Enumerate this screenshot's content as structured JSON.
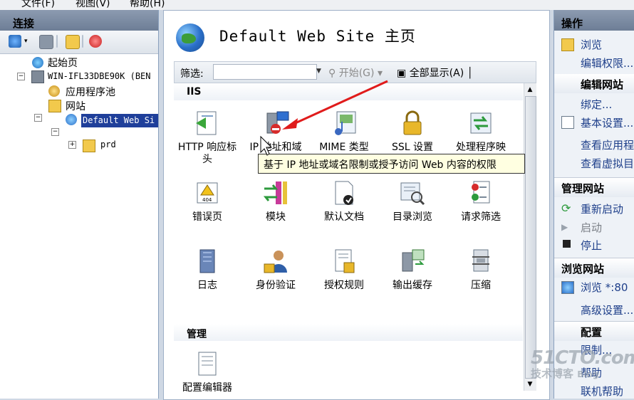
{
  "menu": {
    "items": [
      "文件(F)",
      "视图(V)",
      "帮助(H)"
    ]
  },
  "connections": {
    "title": "连接",
    "tree": {
      "start_page": "起始页",
      "server": "WIN-IFL33DBE90K (BEN",
      "app_pools": "应用程序池",
      "sites": "网站",
      "default_site": "Default Web Si",
      "prd": "prd"
    }
  },
  "center": {
    "title": "Default Web Site 主页",
    "filter_label": "筛选:",
    "filter_value": "",
    "start_label": "开始(G)",
    "show_all_label": "全部显示(A)",
    "sections": [
      {
        "title": "IIS"
      },
      {
        "title": "管理"
      }
    ],
    "iis_features": [
      "HTTP 响应标头",
      "IP 地址和域",
      "MIME 类型",
      "SSL 设置",
      "处理程序映",
      "错误页",
      "模块",
      "默认文档",
      "目录浏览",
      "请求筛选",
      "日志",
      "身份验证",
      "授权规则",
      "输出缓存",
      "压缩"
    ],
    "management_features": [
      "配置编辑器"
    ],
    "tooltip": "基于 IP 地址或域名限制或授予访问 Web 内容的权限"
  },
  "actions": {
    "title": "操作",
    "top": {
      "browse": "浏览",
      "edit_permissions": "编辑权限..."
    },
    "edit_site": {
      "title": "编辑网站",
      "bindings": "绑定...",
      "basic_settings": "基本设置...",
      "view_apps": "查看应用程",
      "view_vdirs": "查看虚拟目"
    },
    "manage_site": {
      "title": "管理网站",
      "restart": "重新启动",
      "start": "启动",
      "stop": "停止"
    },
    "browse_site": {
      "title": "浏览网站",
      "browse_80": "浏览 *:80",
      "advanced": "高级设置..."
    },
    "config": {
      "title": "配置",
      "limits": "限制...",
      "help": "帮助",
      "online_help": "联机帮助"
    }
  },
  "watermark": {
    "line1": "51CTO.com",
    "line2": "技术博客",
    "line3": "Blog"
  },
  "colors": {
    "accent_link": "#1e3f8a",
    "tooltip_bg": "#ffffe1",
    "arrow": "#e01b1b"
  }
}
